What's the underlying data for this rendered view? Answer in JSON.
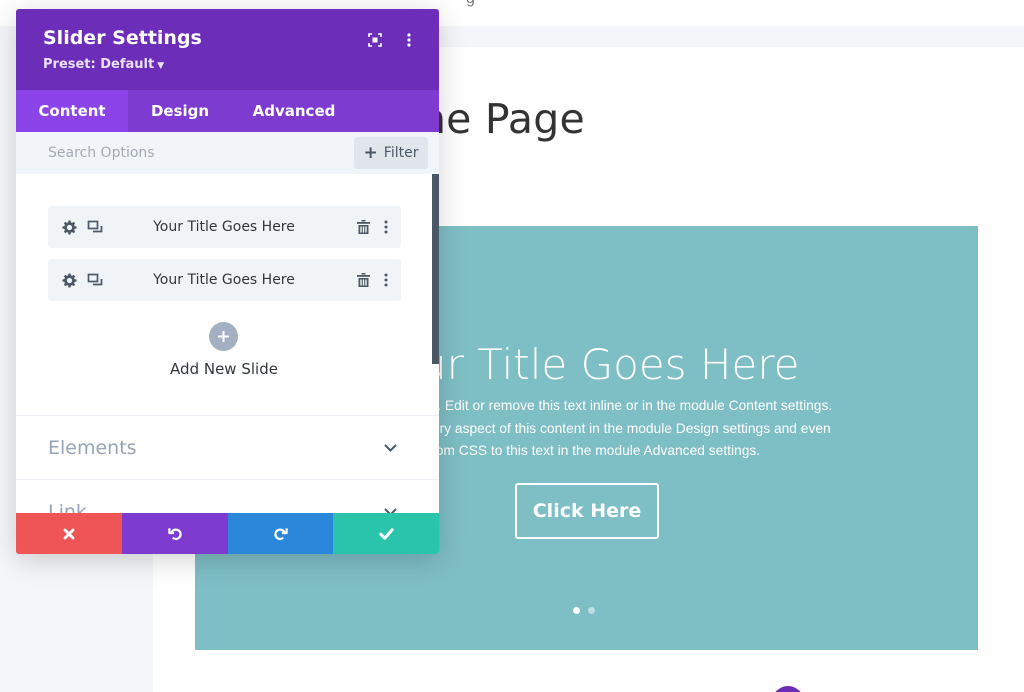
{
  "colors": {
    "header_purple": "#6c2eb9",
    "tab_bar_purple": "#7d3bcf",
    "active_tab_purple": "#8a44e8",
    "cancel_red": "#ef5555",
    "undo_purple": "#7d3bcf",
    "redo_blue": "#2b87da",
    "save_green": "#29c4a9",
    "slider_teal": "#7ebec5"
  },
  "page": {
    "heading_fragment": "ne Page",
    "top_fragment": "g"
  },
  "slider": {
    "title_fragment": "ur Title Goes Here",
    "body_lines": [
      "re. Edit or remove this text inline or in the module Content settings.",
      "very aspect of this content in the module Design settings and even",
      "stom CSS to this text in the module Advanced settings."
    ],
    "button_label": "Click Here",
    "dots": {
      "count": 2,
      "active_index": 0
    }
  },
  "modal": {
    "title": "Slider Settings",
    "preset_label": "Preset: Default",
    "header_icons": [
      "expand-icon",
      "more-vertical-icon"
    ],
    "tabs": [
      {
        "label": "Content",
        "active": true
      },
      {
        "label": "Design",
        "active": false
      },
      {
        "label": "Advanced",
        "active": false
      }
    ],
    "search": {
      "placeholder": "Search Options",
      "filter_label": "Filter"
    },
    "slides": [
      {
        "label": "Your Title Goes Here",
        "icons": [
          "gear-icon",
          "duplicate-icon",
          "trash-icon",
          "more-vertical-icon"
        ]
      },
      {
        "label": "Your Title Goes Here",
        "icons": [
          "gear-icon",
          "duplicate-icon",
          "trash-icon",
          "more-vertical-icon"
        ]
      }
    ],
    "add_slide_label": "Add New Slide",
    "sections": [
      {
        "label": "Elements",
        "icon": "chevron-down-icon"
      },
      {
        "label": "Link",
        "icon": "chevron-down-icon"
      }
    ],
    "footer": {
      "cancel_icon": "close-icon",
      "undo_icon": "undo-icon",
      "redo_icon": "redo-icon",
      "save_icon": "check-icon"
    }
  }
}
